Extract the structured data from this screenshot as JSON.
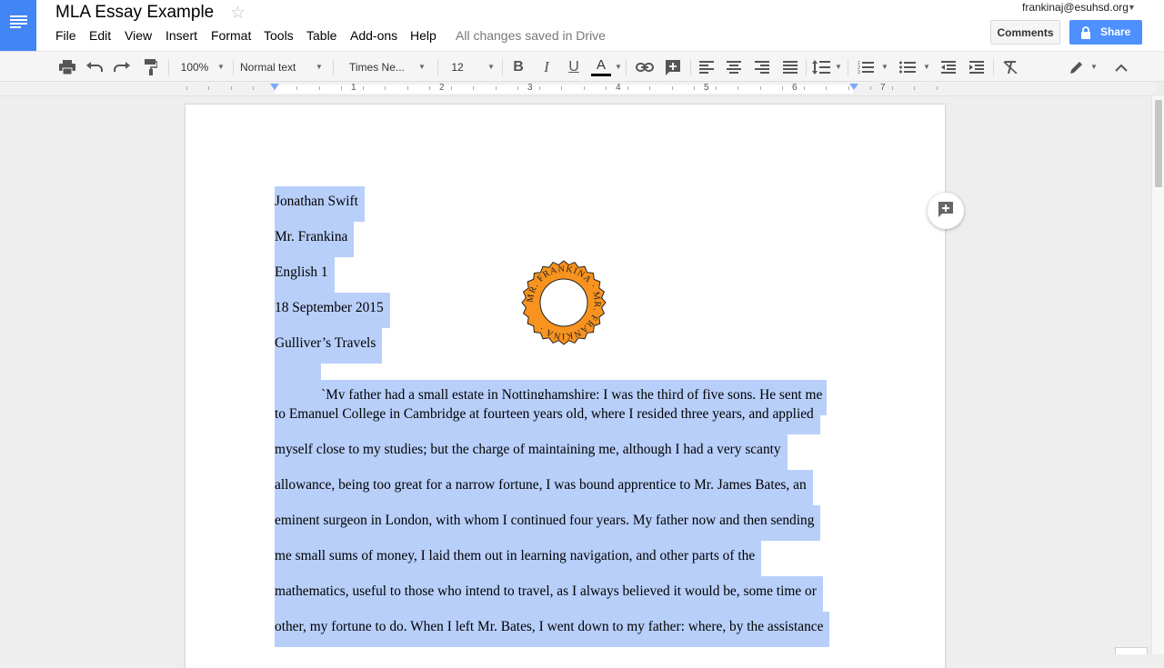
{
  "app": {
    "doc_title": "MLA Essay Example",
    "save_status": "All changes saved in Drive",
    "account_email": "frankinaj@esuhsd.org",
    "comments_label": "Comments",
    "share_label": "Share",
    "accent_color": "#4285f4",
    "selection_color": "#b8cffa"
  },
  "menu": [
    "File",
    "Edit",
    "View",
    "Insert",
    "Format",
    "Tools",
    "Table",
    "Add-ons",
    "Help"
  ],
  "toolbar": {
    "zoom": "100%",
    "style": "Normal text",
    "font": "Times Ne...",
    "font_size": "12",
    "icons": [
      "print-icon",
      "undo-icon",
      "redo-icon",
      "paint-format-icon",
      "bold-icon",
      "italic-icon",
      "underline-icon",
      "text-color-icon",
      "link-icon",
      "insert-comment-icon",
      "align-left-icon",
      "align-center-icon",
      "align-right-icon",
      "justify-icon",
      "line-spacing-icon",
      "numbered-list-icon",
      "bulleted-list-icon",
      "decrease-indent-icon",
      "increase-indent-icon",
      "clear-formatting-icon",
      "editing-mode-icon",
      "collapse-toolbar-icon"
    ]
  },
  "ruler": {
    "numbers": [
      "1",
      "2",
      "3",
      "4",
      "5",
      "6",
      "7"
    ]
  },
  "document": {
    "lines": [
      "Jonathan Swift",
      "Mr. Frankina",
      "English 1",
      "18 September 2015",
      "Gulliver’s Travels",
      "`My father had a small estate in Nottinghamshire: I was the third of five sons. He sent me",
      "to Emanuel College in Cambridge at fourteen years old, where I resided three years, and applied",
      "myself close to my studies; but the charge of maintaining me, although I had a very scanty",
      "allowance, being too great for a narrow fortune, I was bound apprentice to Mr. James Bates, an",
      "eminent surgeon in London, with whom I continued four years. My father now and then sending",
      "me small sums of money, I laid them out in learning navigation, and other parts of the",
      "mathematics, useful to those who intend to travel, as I always believed it would be, some time or",
      "other, my fortune to do. When I left Mr. Bates, I went down to my father: where, by the assistance"
    ],
    "stamp_text": "MR. FRANKINA · MR. FRANKINA ·",
    "stamp_color": "#f7931e"
  }
}
